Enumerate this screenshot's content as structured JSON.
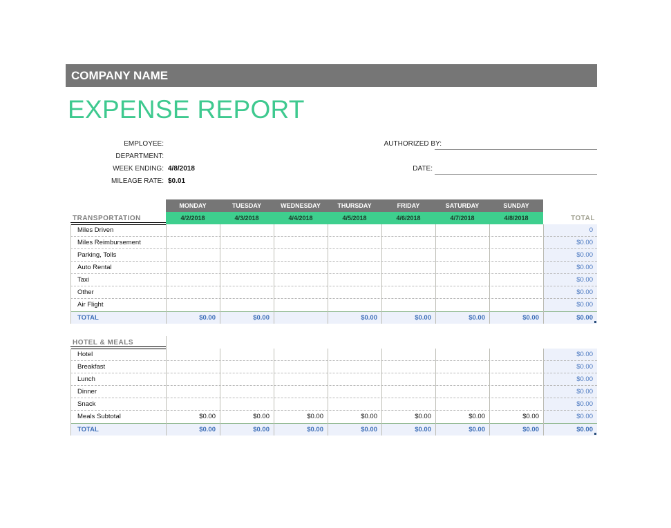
{
  "company_name": "COMPANY NAME",
  "title": "EXPENSE REPORT",
  "info": {
    "employee_label": "EMPLOYEE:",
    "employee_value": "",
    "department_label": "DEPARTMENT:",
    "department_value": "",
    "week_ending_label": "WEEK ENDING:",
    "week_ending_value": "4/8/2018",
    "mileage_rate_label": "MILEAGE RATE:",
    "mileage_rate_value": "$0.01",
    "authorized_by_label": "AUTHORIZED BY:",
    "authorized_by_value": "",
    "date_label": "DATE:",
    "date_value": ""
  },
  "days": [
    {
      "name": "MONDAY",
      "date": "4/2/2018"
    },
    {
      "name": "TUESDAY",
      "date": "4/3/2018"
    },
    {
      "name": "WEDNESDAY",
      "date": "4/4/2018"
    },
    {
      "name": "THURSDAY",
      "date": "4/5/2018"
    },
    {
      "name": "FRIDAY",
      "date": "4/6/2018"
    },
    {
      "name": "SATURDAY",
      "date": "4/7/2018"
    },
    {
      "name": "SUNDAY",
      "date": "4/8/2018"
    }
  ],
  "total_header": "TOTAL",
  "transportation": {
    "title": "TRANSPORTATION",
    "rows": [
      {
        "label": "Miles Driven",
        "values": [
          "",
          "",
          "",
          "",
          "",
          "",
          ""
        ],
        "total": "0"
      },
      {
        "label": "Miles Reimbursement",
        "values": [
          "",
          "",
          "",
          "",
          "",
          "",
          ""
        ],
        "total": "$0.00"
      },
      {
        "label": "Parking, Tolls",
        "values": [
          "",
          "",
          "",
          "",
          "",
          "",
          ""
        ],
        "total": "$0.00"
      },
      {
        "label": "Auto Rental",
        "values": [
          "",
          "",
          "",
          "",
          "",
          "",
          ""
        ],
        "total": "$0.00"
      },
      {
        "label": "Taxi",
        "values": [
          "",
          "",
          "",
          "",
          "",
          "",
          ""
        ],
        "total": "$0.00"
      },
      {
        "label": "Other",
        "values": [
          "",
          "",
          "",
          "",
          "",
          "",
          ""
        ],
        "total": "$0.00"
      },
      {
        "label": "Air Flight",
        "values": [
          "",
          "",
          "",
          "",
          "",
          "",
          ""
        ],
        "total": "$0.00"
      }
    ],
    "total_row": {
      "label": "TOTAL",
      "values": [
        "$0.00",
        "$0.00",
        "",
        "$0.00",
        "$0.00",
        "$0.00",
        "$0.00"
      ],
      "total": "$0.00"
    }
  },
  "hotel_meals": {
    "title": "HOTEL & MEALS",
    "rows": [
      {
        "label": "Hotel",
        "values": [
          "",
          "",
          "",
          "",
          "",
          "",
          ""
        ],
        "total": "$0.00"
      },
      {
        "label": "Breakfast",
        "values": [
          "",
          "",
          "",
          "",
          "",
          "",
          ""
        ],
        "total": "$0.00"
      },
      {
        "label": "Lunch",
        "values": [
          "",
          "",
          "",
          "",
          "",
          "",
          ""
        ],
        "total": "$0.00"
      },
      {
        "label": "Dinner",
        "values": [
          "",
          "",
          "",
          "",
          "",
          "",
          ""
        ],
        "total": "$0.00"
      },
      {
        "label": "Snack",
        "values": [
          "",
          "",
          "",
          "",
          "",
          "",
          ""
        ],
        "total": "$0.00"
      },
      {
        "label": "Meals Subtotal",
        "values": [
          "$0.00",
          "$0.00",
          "$0.00",
          "$0.00",
          "$0.00",
          "$0.00",
          "$0.00"
        ],
        "total": "$0.00"
      }
    ],
    "total_row": {
      "label": "TOTAL",
      "values": [
        "$0.00",
        "$0.00",
        "$0.00",
        "$0.00",
        "$0.00",
        "$0.00",
        "$0.00"
      ],
      "total": "$0.00"
    }
  }
}
